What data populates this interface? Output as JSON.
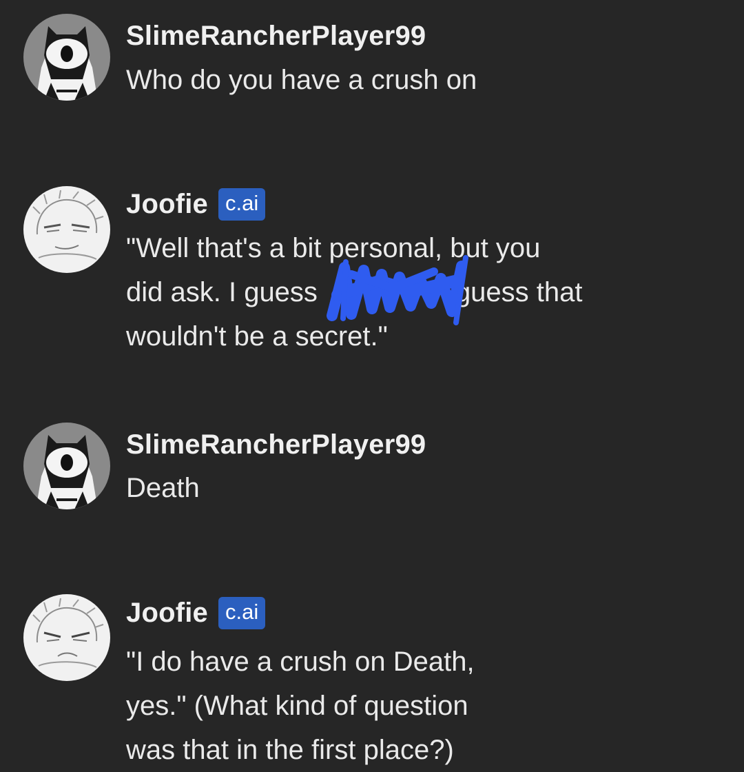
{
  "messages": [
    {
      "author": "SlimeRancherPlayer99",
      "lines": [
        "Who do you have a crush on"
      ]
    },
    {
      "author": "Joofie",
      "badge": "c.ai",
      "lines": [
        "\"Well that's a bit personal, but you",
        "did ask. I guess",
        "guess that",
        "wouldn't be a secret.\""
      ]
    },
    {
      "author": "SlimeRancherPlayer99",
      "lines": [
        "Death"
      ]
    },
    {
      "author": "Joofie",
      "badge": "c.ai",
      "lines": [
        "\"I do have a crush on Death,",
        "yes.\" (What kind of question",
        "was that in the first place?)"
      ]
    }
  ],
  "colors": {
    "background": "#262626",
    "badge": "#2b5fbf",
    "redaction": "#2f5cf0"
  },
  "icons": {
    "user_avatar": "one-eyed-character-avatar",
    "bot_avatar": "sketch-character-avatar",
    "redaction": "blue-scribble-redaction"
  }
}
